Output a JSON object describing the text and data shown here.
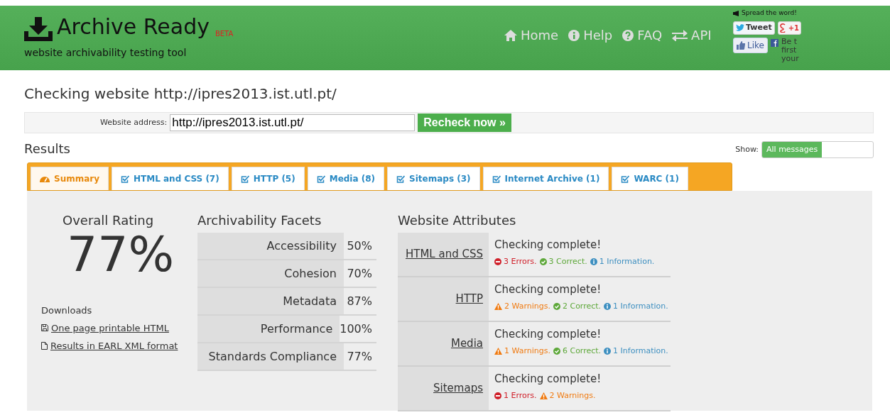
{
  "header": {
    "logo": "Archive Ready",
    "badge": "BETA",
    "tagline": "website archivability testing tool",
    "nav": [
      {
        "label": "Home",
        "kind": "home"
      },
      {
        "label": "Help",
        "kind": "info"
      },
      {
        "label": "FAQ",
        "kind": "question"
      },
      {
        "label": "API",
        "kind": "exchange"
      }
    ],
    "share": {
      "title": "Spread the word!",
      "tweet": "Tweet",
      "plus": "+1",
      "like": "Like",
      "fb_text": [
        "Be t",
        "first",
        "your"
      ]
    }
  },
  "page_title": "Checking website http://ipres2013.ist.utl.pt/",
  "form": {
    "label": "Website address:",
    "value": "http://ipres2013.ist.utl.pt/",
    "button": "Recheck now »"
  },
  "results": {
    "title": "Results",
    "show_label": "Show:",
    "filters": [
      {
        "label": "All messages",
        "selected": true
      }
    ]
  },
  "tabs": [
    {
      "label": "Summary",
      "selected": true,
      "kind": "summary"
    },
    {
      "label": "HTML and CSS (7)",
      "selected": false,
      "kind": "check"
    },
    {
      "label": "HTTP (5)",
      "selected": false,
      "kind": "check"
    },
    {
      "label": "Media (8)",
      "selected": false,
      "kind": "check"
    },
    {
      "label": "Sitemaps (3)",
      "selected": false,
      "kind": "check"
    },
    {
      "label": "Internet Archive (1)",
      "selected": false,
      "kind": "check"
    },
    {
      "label": "WARC (1)",
      "selected": false,
      "kind": "check"
    }
  ],
  "overall": {
    "title": "Overall Rating",
    "value": "77%"
  },
  "downloads": {
    "title": "Downloads",
    "links": [
      {
        "label": "One page printable HTML",
        "kind": "save"
      },
      {
        "label": "Results in EARL XML format",
        "kind": "file"
      }
    ]
  },
  "facets": {
    "title": "Archivability Facets",
    "rows": [
      {
        "name": "Accessibility",
        "value": "50%"
      },
      {
        "name": "Cohesion",
        "value": "70%"
      },
      {
        "name": "Metadata",
        "value": "87%"
      },
      {
        "name": "Performance",
        "value": "100%"
      },
      {
        "name": "Standards Compliance",
        "value": "77%"
      }
    ]
  },
  "attributes": {
    "title": "Website Attributes",
    "rows": [
      {
        "name": "HTML and CSS",
        "status": "Checking complete!",
        "items": [
          {
            "kind": "error",
            "text": "3 Errors."
          },
          {
            "kind": "correct",
            "text": "3 Correct."
          },
          {
            "kind": "info",
            "text": "1 Information."
          }
        ]
      },
      {
        "name": "HTTP",
        "status": "Checking complete!",
        "items": [
          {
            "kind": "warning",
            "text": "2 Warnings."
          },
          {
            "kind": "correct",
            "text": "2 Correct."
          },
          {
            "kind": "info",
            "text": "1 Information."
          }
        ]
      },
      {
        "name": "Media",
        "status": "Checking complete!",
        "items": [
          {
            "kind": "warning",
            "text": "1 Warnings."
          },
          {
            "kind": "correct",
            "text": "6 Correct."
          },
          {
            "kind": "info",
            "text": "1 Information."
          }
        ]
      },
      {
        "name": "Sitemaps",
        "status": "Checking complete!",
        "items": [
          {
            "kind": "error",
            "text": "1 Errors."
          },
          {
            "kind": "warning",
            "text": "2 Warnings."
          }
        ]
      }
    ]
  }
}
